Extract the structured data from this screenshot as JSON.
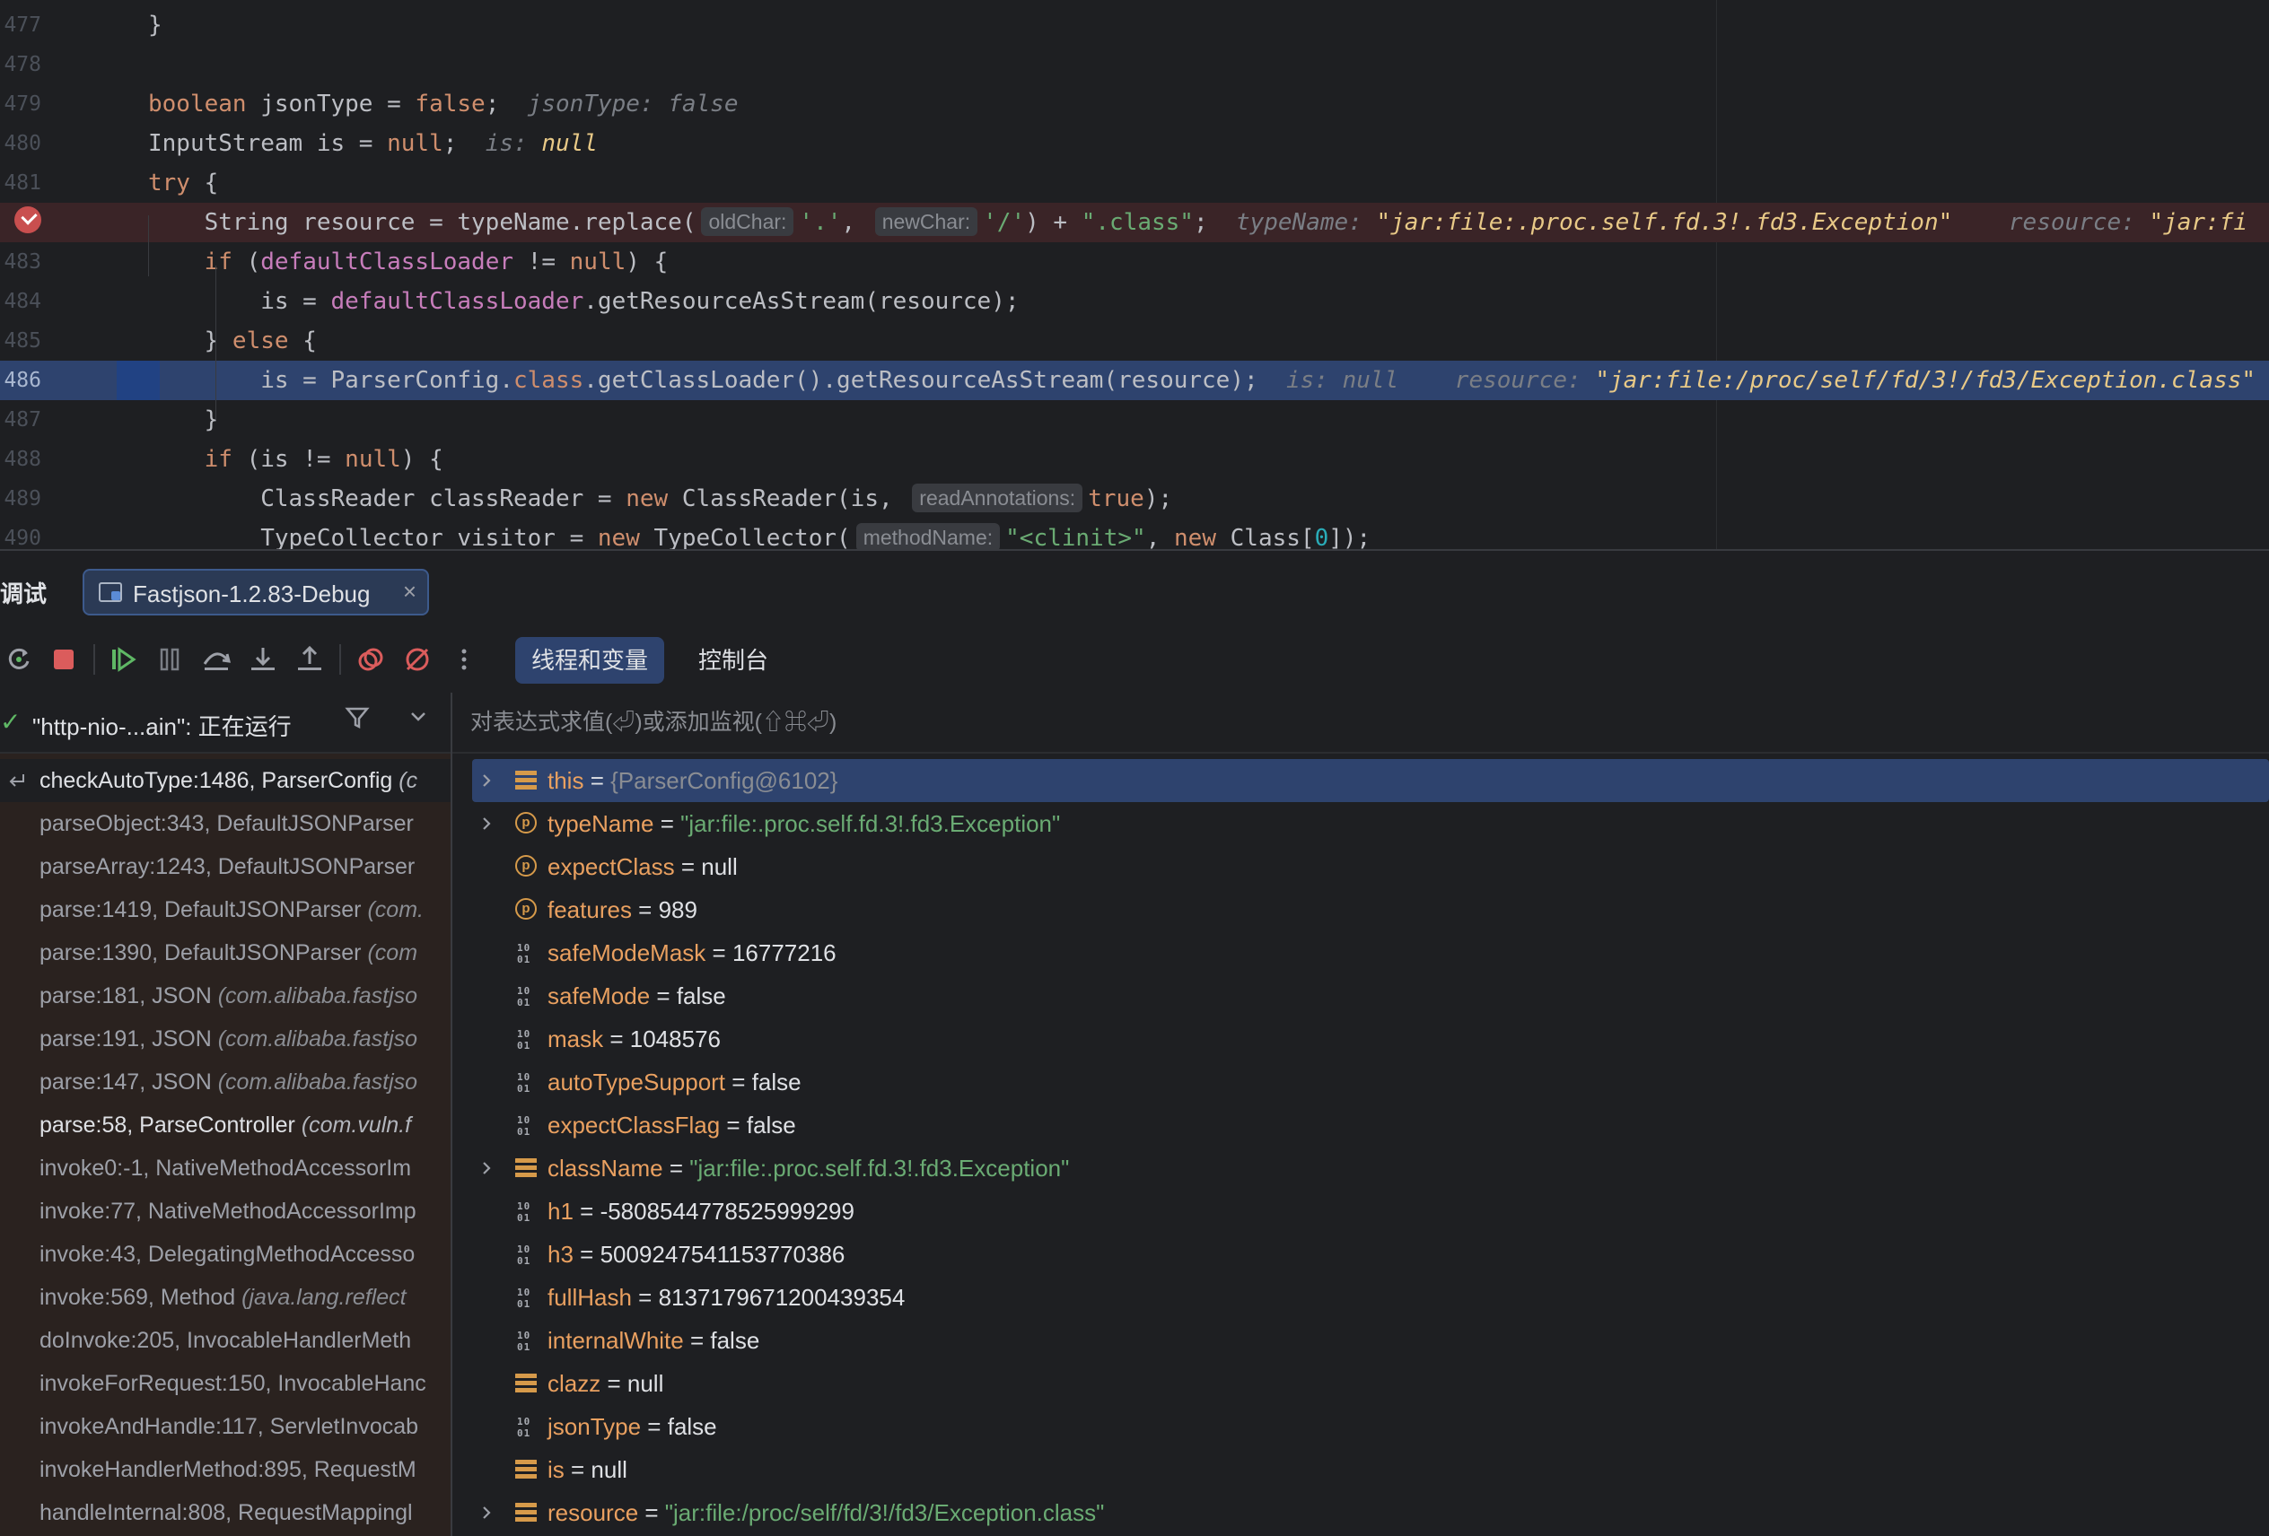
{
  "editor": {
    "lines": [
      {
        "n": "477",
        "parts": [
          [
            "p",
            "}"
          ]
        ]
      },
      {
        "n": "478",
        "parts": []
      },
      {
        "n": "479",
        "parts": [
          [
            "kw",
            "boolean"
          ],
          [
            "p",
            " jsonType = "
          ],
          [
            "kw",
            "false"
          ],
          [
            "p",
            ";  "
          ],
          [
            "hint",
            "jsonType: false"
          ]
        ]
      },
      {
        "n": "480",
        "parts": [
          [
            "p",
            "InputStream is = "
          ],
          [
            "kw",
            "null"
          ],
          [
            "p",
            ";  "
          ],
          [
            "hint",
            "is: "
          ],
          [
            "hval-w",
            "null"
          ]
        ]
      },
      {
        "n": "481",
        "parts": [
          [
            "kw",
            "try"
          ],
          [
            "p",
            " {"
          ]
        ]
      },
      {
        "n": "",
        "bp": true,
        "parts": [
          [
            "p",
            "    String resource = typeName.replace("
          ],
          [
            "inlay",
            "oldChar:"
          ],
          [
            "str",
            "'.'"
          ],
          [
            "p",
            ", "
          ],
          [
            "inlay",
            "newChar:"
          ],
          [
            "str",
            "'/'"
          ],
          [
            "p",
            ") + "
          ],
          [
            "str",
            "\".class\""
          ],
          [
            "p",
            ";  "
          ],
          [
            "hint",
            "typeName: "
          ],
          [
            "hval-w",
            "\"jar:file:.proc.self.fd.3!.fd3.Exception\""
          ],
          [
            "p",
            "    "
          ],
          [
            "hint",
            "resource: "
          ],
          [
            "hval-w",
            "\"jar:fi"
          ]
        ]
      },
      {
        "n": "483",
        "parts": [
          [
            "p",
            "    "
          ],
          [
            "kw",
            "if"
          ],
          [
            "p",
            " ("
          ],
          [
            "fld",
            "defaultClassLoader"
          ],
          [
            "p",
            " != "
          ],
          [
            "kw",
            "null"
          ],
          [
            "p",
            ") {"
          ]
        ]
      },
      {
        "n": "484",
        "parts": [
          [
            "p",
            "        is = "
          ],
          [
            "fld",
            "defaultClassLoader"
          ],
          [
            "p",
            ".getResourceAsStream(resource);"
          ]
        ]
      },
      {
        "n": "485",
        "parts": [
          [
            "p",
            "    } "
          ],
          [
            "kw",
            "else"
          ],
          [
            "p",
            " {"
          ]
        ]
      },
      {
        "n": "486",
        "exec": true,
        "parts": [
          [
            "p",
            "        is = ParserConfig."
          ],
          [
            "kw",
            "class"
          ],
          [
            "p",
            ".getClassLoader().getResourceAsStream(resource);  "
          ],
          [
            "hint",
            "is: null    resource: "
          ],
          [
            "hval-w",
            "\"jar:file:/proc/self/fd/3!/fd3/Exception.class\""
          ]
        ]
      },
      {
        "n": "487",
        "parts": [
          [
            "p",
            "    }"
          ]
        ]
      },
      {
        "n": "488",
        "parts": [
          [
            "p",
            "    "
          ],
          [
            "kw",
            "if"
          ],
          [
            "p",
            " (is != "
          ],
          [
            "kw",
            "null"
          ],
          [
            "p",
            ") {"
          ]
        ]
      },
      {
        "n": "489",
        "parts": [
          [
            "p",
            "        ClassReader classReader = "
          ],
          [
            "kw",
            "new"
          ],
          [
            "p",
            " ClassReader(is, "
          ],
          [
            "inlay",
            "readAnnotations:"
          ],
          [
            "kw",
            "true"
          ],
          [
            "p",
            ");"
          ]
        ]
      },
      {
        "n": "490",
        "parts": [
          [
            "p",
            "        TypeCollector visitor = "
          ],
          [
            "kw",
            "new"
          ],
          [
            "p",
            " TypeCollector("
          ],
          [
            "inlay",
            "methodName:"
          ],
          [
            "str",
            "\"<clinit>\""
          ],
          [
            "p",
            ", "
          ],
          [
            "kw",
            "new"
          ],
          [
            "p",
            " Class["
          ],
          [
            "num",
            "0"
          ],
          [
            "p",
            "]);"
          ]
        ]
      }
    ]
  },
  "tool": {
    "title": "调试",
    "session_tab": "Fastjson-1.2.83-Debug",
    "close": "×",
    "view_tabs": [
      "线程和变量",
      "控制台"
    ],
    "toolbar_icons": [
      "rerun-icon",
      "stop-icon",
      "resume-icon",
      "pause-icon",
      "step-over-icon",
      "step-into-icon",
      "step-out-icon",
      "view-breakpoints-icon",
      "mute-breakpoints-icon",
      "more-icon"
    ]
  },
  "threads": {
    "selected": "\"http-nio-...ain\": 正在运行",
    "check": "✓",
    "filter": "⊽",
    "dropdown": "⌄"
  },
  "frames": [
    {
      "m": "checkAutoType:1486, ParserConfig",
      "p": " (c",
      "current": true
    },
    {
      "m": "parseObject:343, DefaultJSONParser",
      "p": ""
    },
    {
      "m": "parseArray:1243, DefaultJSONParser",
      "p": ""
    },
    {
      "m": "parse:1419, DefaultJSONParser",
      "p": " (com."
    },
    {
      "m": "parse:1390, DefaultJSONParser",
      "p": " (com"
    },
    {
      "m": "parse:181, JSON",
      "p": " (com.alibaba.fastjso"
    },
    {
      "m": "parse:191, JSON",
      "p": " (com.alibaba.fastjso"
    },
    {
      "m": "parse:147, JSON",
      "p": " (com.alibaba.fastjso"
    },
    {
      "m": "parse:58, ParseController",
      "p": " (com.vuln.f",
      "user": true
    },
    {
      "m": "invoke0:-1, NativeMethodAccessorIm",
      "p": ""
    },
    {
      "m": "invoke:77, NativeMethodAccessorImp",
      "p": ""
    },
    {
      "m": "invoke:43, DelegatingMethodAccesso",
      "p": ""
    },
    {
      "m": "invoke:569, Method",
      "p": " (java.lang.reflect"
    },
    {
      "m": "doInvoke:205, InvocableHandlerMeth",
      "p": ""
    },
    {
      "m": "invokeForRequest:150, InvocableHanc",
      "p": ""
    },
    {
      "m": "invokeAndHandle:117, ServletInvocab",
      "p": ""
    },
    {
      "m": "invokeHandlerMethod:895, RequestM",
      "p": ""
    },
    {
      "m": "handleInternal:808, RequestMappingl",
      "p": ""
    }
  ],
  "evaluate": {
    "placeholder": "对表达式求值(⏎)或添加监视(⇧⌘⏎)"
  },
  "variables": [
    {
      "name": "this",
      "val": "{ParserConfig@6102}",
      "type": "ref",
      "icon": "obj",
      "expand": true,
      "sel": true
    },
    {
      "name": "typeName",
      "val": "\"jar:file:.proc.self.fd.3!.fd3.Exception\"",
      "type": "s",
      "icon": "param",
      "expand": true
    },
    {
      "name": "expectClass",
      "val": "null",
      "type": "p",
      "icon": "param"
    },
    {
      "name": "features",
      "val": "989",
      "type": "p",
      "icon": "param"
    },
    {
      "name": "safeModeMask",
      "val": "16777216",
      "type": "p",
      "icon": "prim"
    },
    {
      "name": "safeMode",
      "val": "false",
      "type": "p",
      "icon": "prim"
    },
    {
      "name": "mask",
      "val": "1048576",
      "type": "p",
      "icon": "prim"
    },
    {
      "name": "autoTypeSupport",
      "val": "false",
      "type": "p",
      "icon": "prim"
    },
    {
      "name": "expectClassFlag",
      "val": "false",
      "type": "p",
      "icon": "prim"
    },
    {
      "name": "className",
      "val": "\"jar:file:.proc.self.fd.3!.fd3.Exception\"",
      "type": "s",
      "icon": "obj",
      "expand": true
    },
    {
      "name": "h1",
      "val": "-5808544778525999299",
      "type": "p",
      "icon": "prim"
    },
    {
      "name": "h3",
      "val": "5009247541153770386",
      "type": "p",
      "icon": "prim"
    },
    {
      "name": "fullHash",
      "val": "8137179671200439354",
      "type": "p",
      "icon": "prim"
    },
    {
      "name": "internalWhite",
      "val": "false",
      "type": "p",
      "icon": "prim"
    },
    {
      "name": "clazz",
      "val": "null",
      "type": "p",
      "icon": "obj"
    },
    {
      "name": "jsonType",
      "val": "false",
      "type": "p",
      "icon": "prim"
    },
    {
      "name": "is",
      "val": "null",
      "type": "p",
      "icon": "obj"
    },
    {
      "name": "resource",
      "val": "\"jar:file:/proc/self/fd/3!/fd3/Exception.class\"",
      "type": "s",
      "icon": "obj",
      "expand": true
    }
  ],
  "icons": {
    "param_glyph": "p",
    "prim_glyph": "10\n01",
    "chevron": "›"
  }
}
